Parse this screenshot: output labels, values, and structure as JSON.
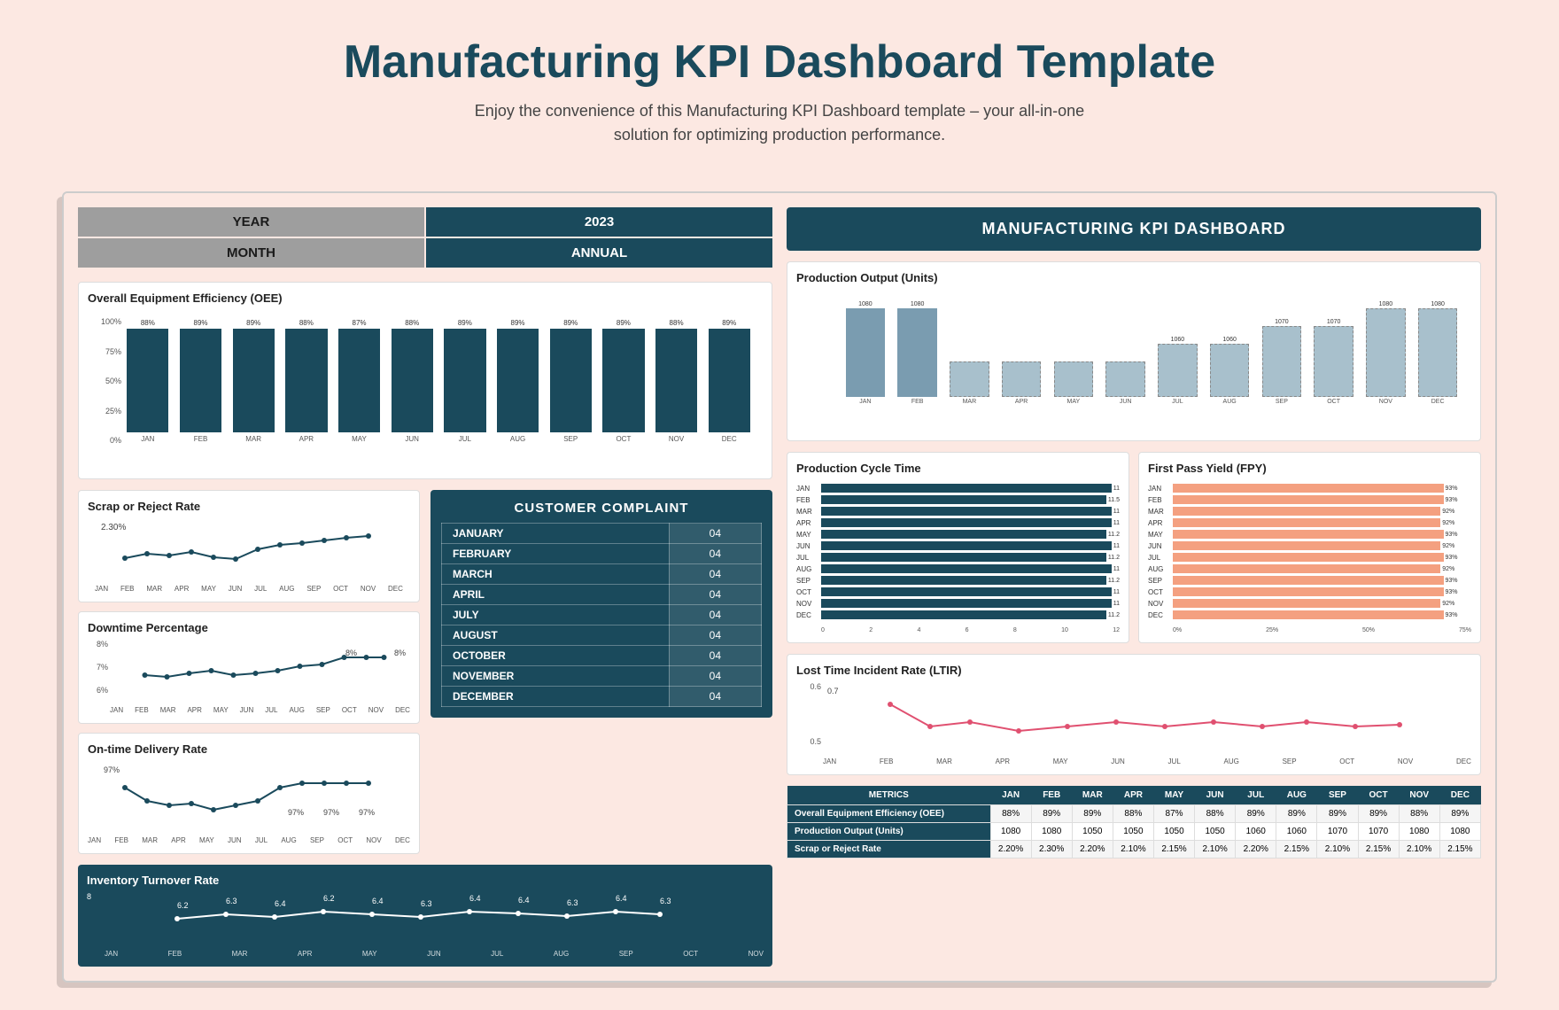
{
  "header": {
    "title": "Manufacturing KPI Dashboard Template",
    "subtitle": "Enjoy the convenience of this Manufacturing KPI Dashboard template – your all-in-one solution for optimizing production performance."
  },
  "dashboard": {
    "year_label": "YEAR",
    "year_value": "2023",
    "month_label": "MONTH",
    "month_value": "ANNUAL",
    "right_header": "MANUFACTURING KPI DASHBOARD"
  },
  "oee": {
    "title": "Overall Equipment Efficiency (OEE)",
    "y_labels": [
      "100%",
      "75%",
      "50%",
      "25%",
      "0%"
    ],
    "bars": [
      {
        "month": "JAN",
        "value": 88,
        "label": "88%"
      },
      {
        "month": "FEB",
        "value": 89,
        "label": "89%"
      },
      {
        "month": "MAR",
        "value": 89,
        "label": "89%"
      },
      {
        "month": "APR",
        "value": 88,
        "label": "88%"
      },
      {
        "month": "MAY",
        "value": 87,
        "label": "87%"
      },
      {
        "month": "JUN",
        "value": 88,
        "label": "88%"
      },
      {
        "month": "JUL",
        "value": 89,
        "label": "89%"
      },
      {
        "month": "AUG",
        "value": 89,
        "label": "89%"
      },
      {
        "month": "SEP",
        "value": 89,
        "label": "89%"
      },
      {
        "month": "OCT",
        "value": 89,
        "label": "89%"
      },
      {
        "month": "NOV",
        "value": 88,
        "label": "88%"
      },
      {
        "month": "DEC",
        "value": 89,
        "label": "89%"
      }
    ]
  },
  "production_output": {
    "title": "Production Output (Units)",
    "bars": [
      {
        "month": "JAN",
        "value": 1080,
        "label": "1080",
        "solid": true
      },
      {
        "month": "FEB",
        "value": 1080,
        "label": "1080",
        "solid": true
      },
      {
        "month": "MAR",
        "value": 1050,
        "label": "",
        "solid": false
      },
      {
        "month": "APR",
        "value": 1050,
        "label": "",
        "solid": false
      },
      {
        "month": "MAY",
        "value": 1050,
        "label": "",
        "solid": false
      },
      {
        "month": "JUN",
        "value": 1050,
        "label": "",
        "solid": false
      },
      {
        "month": "JUL",
        "value": 1060,
        "label": "1060",
        "solid": false
      },
      {
        "month": "AUG",
        "value": 1060,
        "label": "1060",
        "solid": false
      },
      {
        "month": "SEP",
        "value": 1070,
        "label": "1070",
        "solid": false
      },
      {
        "month": "OCT",
        "value": 1070,
        "label": "1070",
        "solid": false
      },
      {
        "month": "NOV",
        "value": 1080,
        "label": "1080",
        "solid": false
      },
      {
        "month": "DEC",
        "value": 1080,
        "label": "1080",
        "solid": false
      }
    ]
  },
  "scrap_rate": {
    "title": "Scrap or Reject Rate",
    "highlight": "2.30%",
    "months": [
      "JAN",
      "FEB",
      "MAR",
      "APR",
      "MAY",
      "JUN",
      "JUL",
      "AUG",
      "SEP",
      "OCT",
      "NOV",
      "DEC"
    ]
  },
  "downtime": {
    "title": "Downtime Percentage",
    "y_labels": [
      "8%",
      "7%",
      "6%"
    ],
    "highlights": [
      "8%",
      "8%"
    ],
    "months": [
      "JAN",
      "FEB",
      "MAR",
      "APR",
      "MAY",
      "JUN",
      "JUL",
      "AUG",
      "SEP",
      "OCT",
      "NOV",
      "DEC"
    ]
  },
  "delivery": {
    "title": "On-time Delivery Rate",
    "highlights": [
      "97%",
      "97%",
      "97%",
      "97%"
    ],
    "months": [
      "JAN",
      "FEB",
      "MAR",
      "APR",
      "MAY",
      "JUN",
      "JUL",
      "AUG",
      "SEP",
      "OCT",
      "NOV",
      "DEC"
    ]
  },
  "inventory": {
    "title": "Inventory Turnover Rate",
    "y_value": "8",
    "values": [
      "6.2",
      "6.3",
      "6.4",
      "6.2",
      "6.4",
      "6.3",
      "6.4",
      "6.4",
      "6.3",
      "6.4",
      "6.3"
    ]
  },
  "customer_complaint": {
    "title": "CUSTOMER COMPLAINT",
    "rows": [
      {
        "month": "JANUARY",
        "value": "04"
      },
      {
        "month": "FEBRUARY",
        "value": "04"
      },
      {
        "month": "MARCH",
        "value": "04"
      },
      {
        "month": "APRIL",
        "value": "04"
      },
      {
        "month": "JULY",
        "value": "04"
      },
      {
        "month": "AUGUST",
        "value": "04"
      },
      {
        "month": "OCTOBER",
        "value": "04"
      },
      {
        "month": "NOVEMBER",
        "value": "04"
      },
      {
        "month": "DECEMBER",
        "value": "04"
      }
    ]
  },
  "cycle_time": {
    "title": "Production Cycle Time",
    "rows": [
      {
        "month": "JAN",
        "value": 11,
        "label": "11"
      },
      {
        "month": "FEB",
        "value": 11.5,
        "label": "11.5"
      },
      {
        "month": "MAR",
        "value": 11,
        "label": "11"
      },
      {
        "month": "APR",
        "value": 11,
        "label": "11"
      },
      {
        "month": "MAY",
        "value": 11.2,
        "label": "11.2"
      },
      {
        "month": "JUN",
        "value": 11,
        "label": "11"
      },
      {
        "month": "JUL",
        "value": 11.2,
        "label": "11.2"
      },
      {
        "month": "AUG",
        "value": 11,
        "label": "11"
      },
      {
        "month": "SEP",
        "value": 11.2,
        "label": "11.2"
      },
      {
        "month": "OCT",
        "value": 11,
        "label": "11"
      },
      {
        "month": "NOV",
        "value": 11,
        "label": "11"
      },
      {
        "month": "DEC",
        "value": 11.2,
        "label": "11.2"
      }
    ],
    "x_labels": [
      "0",
      "2",
      "4",
      "6",
      "8",
      "10",
      "12"
    ],
    "max": 12
  },
  "fpy": {
    "title": "First Pass Yield (FPY)",
    "rows": [
      {
        "month": "JAN",
        "value": 93,
        "label": "93%"
      },
      {
        "month": "FEB",
        "value": 93,
        "label": "93%"
      },
      {
        "month": "MAR",
        "value": 92,
        "label": "92%"
      },
      {
        "month": "APR",
        "value": 92,
        "label": "92%"
      },
      {
        "month": "MAY",
        "value": 93,
        "label": "93%"
      },
      {
        "month": "JUN",
        "value": 92,
        "label": "92%"
      },
      {
        "month": "JUL",
        "value": 93,
        "label": "93%"
      },
      {
        "month": "AUG",
        "value": 92,
        "label": "92%"
      },
      {
        "month": "SEP",
        "value": 93,
        "label": "93%"
      },
      {
        "month": "OCT",
        "value": 93,
        "label": "93%"
      },
      {
        "month": "NOV",
        "value": 92,
        "label": "92%"
      },
      {
        "month": "DEC",
        "value": 93,
        "label": "93%"
      }
    ],
    "x_labels": [
      "0%",
      "25%",
      "50%",
      "75%"
    ],
    "max": 100
  },
  "ltir": {
    "title": "Lost Time Incident Rate (LTIR)",
    "y_labels": [
      "0.6",
      "0.5"
    ],
    "highlight": "0.7",
    "months": [
      "JAN",
      "FEB",
      "MAR",
      "APR",
      "MAY",
      "JUN",
      "JUL",
      "AUG",
      "SEP",
      "OCT",
      "NOV",
      "DEC"
    ]
  },
  "bottom_table": {
    "headers": [
      "METRICS",
      "JAN",
      "FEB",
      "MAR",
      "APR",
      "MAY",
      "JUN",
      "JUL",
      "AUG",
      "SEP",
      "OCT",
      "NOV",
      "DEC"
    ],
    "rows": [
      {
        "label": "Overall Equipment Efficiency (OEE)",
        "values": [
          "88%",
          "89%",
          "89%",
          "88%",
          "87%",
          "88%",
          "89%",
          "89%",
          "89%",
          "89%",
          "88%",
          "89%"
        ]
      },
      {
        "label": "Production Output (Units)",
        "values": [
          "1080",
          "1080",
          "1050",
          "1050",
          "1050",
          "1050",
          "1060",
          "1060",
          "1070",
          "1070",
          "1080",
          "1080"
        ]
      },
      {
        "label": "Scrap or Reject Rate",
        "values": [
          "2.20%",
          "2.30%",
          "2.20%",
          "2.10%",
          "2.15%",
          "2.10%",
          "2.20%",
          "2.15%",
          "2.10%",
          "2.15%",
          "2.10%",
          "2.15%"
        ]
      }
    ]
  }
}
